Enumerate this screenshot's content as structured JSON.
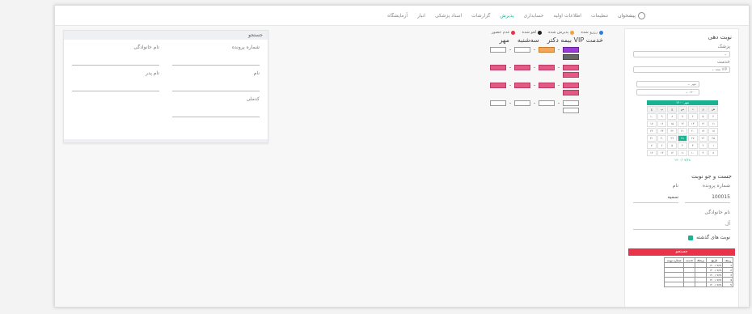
{
  "nav": {
    "brand": "پیشخوان",
    "items": [
      "تنظیمات",
      "اطلاعات اولیه",
      "حسابداری",
      "پذیرش",
      "گزارشات",
      "اسناد پزشکی",
      "انبار",
      "آزمایشگاه"
    ],
    "active_index": 3
  },
  "reserve": {
    "title": "نوبت دهی",
    "doctor_label": "پزشک",
    "service_label": "خدمت",
    "service_value": "VIP بیمه",
    "month_value": "مهر",
    "year_value": "۱۴۰۰",
    "calendar": {
      "header": "مهر ۱۴۰۰",
      "days": [
        "ش",
        "ی",
        "د",
        "س",
        "چ",
        "پ",
        "ج"
      ],
      "rows": [
        [
          "۴",
          "۵",
          "۶",
          "۷",
          "۸",
          "۹",
          "۱۰"
        ],
        [
          "۱۱",
          "۱۲",
          "۱۳",
          "۱۴",
          "۱۵",
          "۱۶",
          "۱۷"
        ],
        [
          "۱۸",
          "۱۹",
          "۲۰",
          "۲۱",
          "۲۲",
          "۲۳",
          "۲۴"
        ],
        [
          "۲۵",
          "۲۶",
          "۲۷",
          "۲۸",
          "۲۹",
          "۳۰",
          "۳۱"
        ],
        [
          "۱",
          "۲",
          "۳",
          "۴",
          "۵",
          "۶",
          "۷"
        ],
        [
          "۸",
          "۹",
          "۱۰",
          "۱۱",
          "۱۲",
          "۱۳",
          "۱۴"
        ]
      ],
      "selected": "۲۸",
      "date_text": "۱۴۰۰/۰۷/۲۸"
    }
  },
  "search": {
    "title": "جست و جو نوبت",
    "file_label": "شماره پرونده",
    "file_value": "100015",
    "name_label": "نام",
    "name_value": "سمیه",
    "family_label": "نام خانوادگی",
    "family_value": "آل",
    "past_label": "نوبت های گذشته",
    "button": "جستجو",
    "table_headers": [
      "ردیف",
      "تاریخ",
      "پزشک",
      "خدمت",
      "شماره نوبت"
    ],
    "table_rows": [
      [
        "1",
        "۱۴۰۰/۰۷/۲۸",
        "",
        "",
        ""
      ],
      [
        "2",
        "۱۴۰۰/۰۷/۲۸",
        "",
        "",
        ""
      ],
      [
        "3",
        "۱۴۰۰/۰۷/۲۸",
        "",
        "",
        ""
      ],
      [
        "4",
        "۱۴۰۰/۰۷/۲۸",
        "",
        "",
        ""
      ],
      [
        "5",
        "۱۴۰۰/۰۷/۲۸",
        "",
        "",
        ""
      ]
    ]
  },
  "schedule": {
    "legend": [
      {
        "label": "رزرو شده",
        "color": "#2f7fd6"
      },
      {
        "label": "پذیرش شده",
        "color": "#f0a43a"
      },
      {
        "label": "لغو شده",
        "color": "#222222"
      },
      {
        "label": "عدم حضور",
        "color": "#e8334a"
      }
    ],
    "service_title": "خدمت VIP بیمه دکتر",
    "day": "سه‌شنبه",
    "month": "مهر"
  },
  "left_panel": {
    "title": "جستجو",
    "fields": [
      "شماره پرونده",
      "نام خانوادگی",
      "نام",
      "نام پدر",
      "کدملی"
    ]
  }
}
